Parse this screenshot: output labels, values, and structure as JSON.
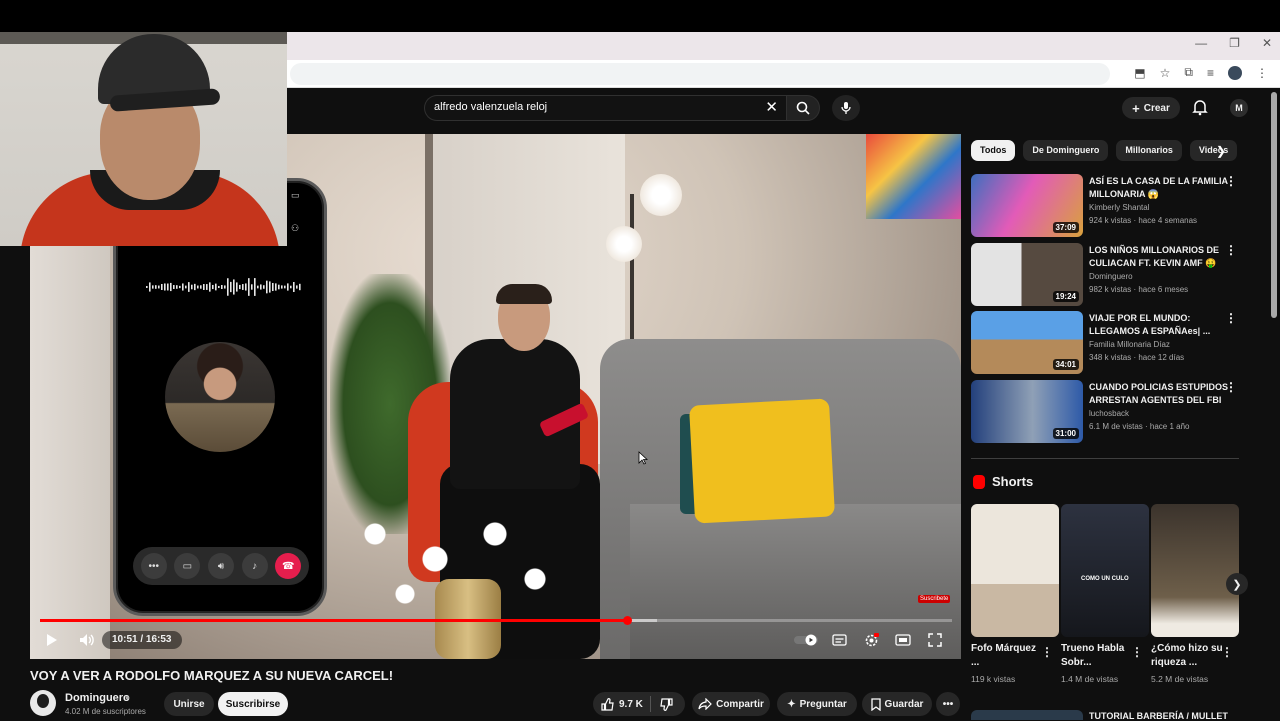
{
  "browser": {
    "window_controls": [
      "—",
      "❐",
      "✕"
    ]
  },
  "header": {
    "search_value": "alfredo valenzuela reloj",
    "create_label": "Crear",
    "user_initials": "M"
  },
  "player": {
    "time_current": "10:51",
    "time_total": "16:53",
    "timecode": "10:51 / 16:53",
    "progress": 0.643,
    "watermark": "Suscribete"
  },
  "video": {
    "title": "VOY A VER A RODOLFO MARQUEZ A SU NUEVA CARCEL!",
    "channel": "Dominguero",
    "subscribers": "4.02 M de suscriptores",
    "join_label": "Unirse",
    "subscribe_label": "Suscribirse",
    "likes": "9.7 K",
    "share_label": "Compartir",
    "ask_label": "Preguntar",
    "save_label": "Guardar"
  },
  "chips": [
    "Todos",
    "De Dominguero",
    "Millonarios",
    "Videos"
  ],
  "recommendations": [
    {
      "title": "ASÍ ES LA CASA DE LA FAMILIA MILLONARIA 😱",
      "channel": "Kimberly Shantal",
      "meta": "924 k vistas · hace 4 semanas",
      "duration": "37:09",
      "thumb_colors": [
        "#3d6fbf",
        "#c44fa8"
      ]
    },
    {
      "title": "LOS NIÑOS MILLONARIOS DE CULIACAN FT. KEVIN AMF 🤑",
      "channel": "Dominguero",
      "meta": "982 k vistas · hace 6 meses",
      "duration": "19:24",
      "thumb_colors": [
        "#d8d8d8",
        "#3a2f2a"
      ]
    },
    {
      "title": "VIAJE POR EL MUNDO: LLEGAMOS A ESPAÑAes| ...",
      "channel": "Familia Millonaria Díaz",
      "meta": "348 k vistas · hace 12 días",
      "duration": "34:01",
      "thumb_colors": [
        "#4a8fd8",
        "#c8a065"
      ]
    },
    {
      "title": "CUANDO POLICIAS ESTUPIDOS ARRESTAN AGENTES DEL FBI",
      "channel": "luchosback",
      "meta": "6.1 M de vistas · hace 1 año",
      "duration": "31:00",
      "thumb_colors": [
        "#2b4a8a",
        "#9aa6b5"
      ]
    }
  ],
  "shorts_heading": "Shorts",
  "shorts": [
    {
      "title": "Fofo Márquez ...",
      "views": "119 k vistas",
      "thumb_colors": [
        "#e9e2d7",
        "#6b5848"
      ]
    },
    {
      "title": "Trueno Habla Sobr...",
      "views": "1.4 M de vistas",
      "thumb_colors": [
        "#2a2f3a",
        "#1a1a1a"
      ],
      "caption": "COMO UN CULO"
    },
    {
      "title": "¿Cómo hizo su riqueza ...",
      "views": "5.2 M de vistas",
      "thumb_colors": [
        "#3b332c",
        "#8a7a62"
      ]
    }
  ],
  "bottom_rec_title": "TUTORIAL BARBERÍA / MULLET"
}
